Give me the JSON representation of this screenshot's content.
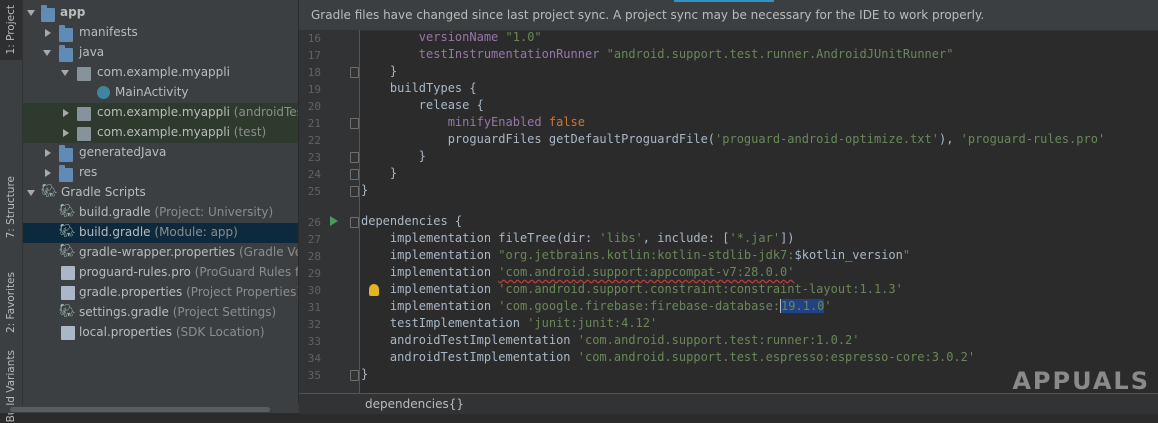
{
  "side_tabs": {
    "project": "1: Project",
    "structure": "7: Structure",
    "favorites": "2: Favorites",
    "build_variants": "Build Variants"
  },
  "tree": [
    {
      "label": "app",
      "hint": "",
      "expanded": true
    },
    {
      "label": "manifests",
      "hint": "",
      "expanded": false
    },
    {
      "label": "java",
      "hint": "",
      "expanded": true
    },
    {
      "label": "com.example.myappli",
      "hint": "",
      "expanded": true
    },
    {
      "label": "MainActivity",
      "hint": ""
    },
    {
      "label": "com.example.myappli",
      "hint": "(androidTest)",
      "expanded": false
    },
    {
      "label": "com.example.myappli",
      "hint": "(test)",
      "expanded": false
    },
    {
      "label": "generatedJava",
      "hint": "",
      "expanded": false
    },
    {
      "label": "res",
      "hint": "",
      "expanded": false
    },
    {
      "label": "Gradle Scripts",
      "hint": "",
      "expanded": true
    },
    {
      "label": "build.gradle",
      "hint": "(Project: University)"
    },
    {
      "label": "build.gradle",
      "hint": "(Module: app)"
    },
    {
      "label": "gradle-wrapper.properties",
      "hint": "(Gradle Version"
    },
    {
      "label": "proguard-rules.pro",
      "hint": "(ProGuard Rules for ap"
    },
    {
      "label": "gradle.properties",
      "hint": "(Project Properties)"
    },
    {
      "label": "settings.gradle",
      "hint": "(Project Settings)"
    },
    {
      "label": "local.properties",
      "hint": "(SDK Location)"
    }
  ],
  "banner": "Gradle files have changed since last project sync. A project sync may be necessary for the IDE to work properly.",
  "line_numbers": [
    "16",
    "17",
    "18",
    "19",
    "20",
    "21",
    "22",
    "23",
    "24",
    "25",
    "26",
    "27",
    "28",
    "29",
    "30",
    "31",
    "32",
    "33",
    "34",
    "35"
  ],
  "code": {
    "l16_key": "versionName",
    "l16_val": "\"1.0\"",
    "l17_key": "testInstrumentationRunner",
    "l17_val": "\"android.support.test.runner.AndroidJUnitRunner\"",
    "l18": "}",
    "l19": "buildTypes {",
    "l20": "release {",
    "l21_key": "minifyEnabled",
    "l21_val": "false",
    "l22_a": "proguardFiles getDefaultProguardFile(",
    "l22_b": "'proguard-android-optimize.txt'",
    "l22_c": "), ",
    "l22_d": "'proguard-rules.pro'",
    "l23": "}",
    "l24": "}",
    "l25": "}",
    "l27": "dependencies {",
    "l28_a": "implementation fileTree(",
    "l28_b": "dir: ",
    "l28_c": "'libs'",
    "l28_d": ", ",
    "l28_e": "include: ",
    "l28_f": "[",
    "l28_g": "'*.jar'",
    "l28_h": "])",
    "l29_a": "implementation ",
    "l29_b": "\"org.jetbrains.kotlin:kotlin-stdlib-jdk7:",
    "l29_c": "$kotlin_version",
    "l29_d": "\"",
    "l30_a": "implementation ",
    "l30_b": "'com.android.support:appcompat-v7:28.0.0'",
    "l31_a": "implementation ",
    "l31_b": "'com.android.support.constraint:constraint-layout:1.1.3'",
    "l32_a": "implementation ",
    "l32_b": "'com.google.firebase:firebase-database:",
    "l32_c": "19.1.0",
    "l32_d": "'",
    "l33_a": "testImplementation ",
    "l33_b": "'junit:junit:4.12'",
    "l34_a": "androidTestImplementation ",
    "l34_b": "'com.android.support.test:runner:1.0.2'",
    "l35_a": "androidTestImplementation ",
    "l35_b": "'com.android.support.test.espresso:espresso-core:3.0.2'",
    "l36": "}"
  },
  "status_breadcrumb": "dependencies{}",
  "watermark": "APPUALS",
  "colors": {
    "keyword": "#cc7832",
    "string": "#6a8759",
    "property": "#9876aa",
    "selection": "#214283"
  }
}
